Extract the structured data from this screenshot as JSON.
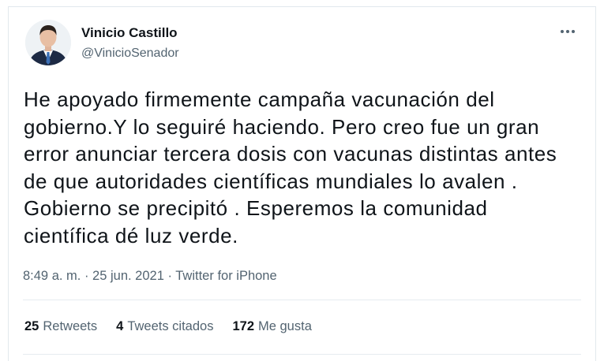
{
  "author": {
    "display_name": "Vinicio Castillo",
    "handle": "@VinicioSenador"
  },
  "tweet": {
    "text": "He apoyado firmemente campaña vacunación del\ngobierno.Y lo seguiré haciendo. Pero creo fue un gran\nerror anunciar tercera dosis con vacunas distintas antes\nde que autoridades científicas mundiales lo avalen .\nGobierno se precipitó . Esperemos la comunidad\ncientífica dé luz verde.",
    "time": "8:49 a. m.",
    "separator": " · ",
    "date": "25 jun. 2021",
    "source": "Twitter for iPhone"
  },
  "stats": {
    "retweets_count": "25",
    "retweets_label": "Retweets",
    "quotes_count": "4",
    "quotes_label": "Tweets citados",
    "likes_count": "172",
    "likes_label": "Me gusta"
  },
  "icons": {
    "more": "more-horizontal-icon",
    "avatar": "profile-photo"
  },
  "colors": {
    "text_primary": "#0f1419",
    "text_secondary": "#536471",
    "border": "#e1e8ed"
  }
}
